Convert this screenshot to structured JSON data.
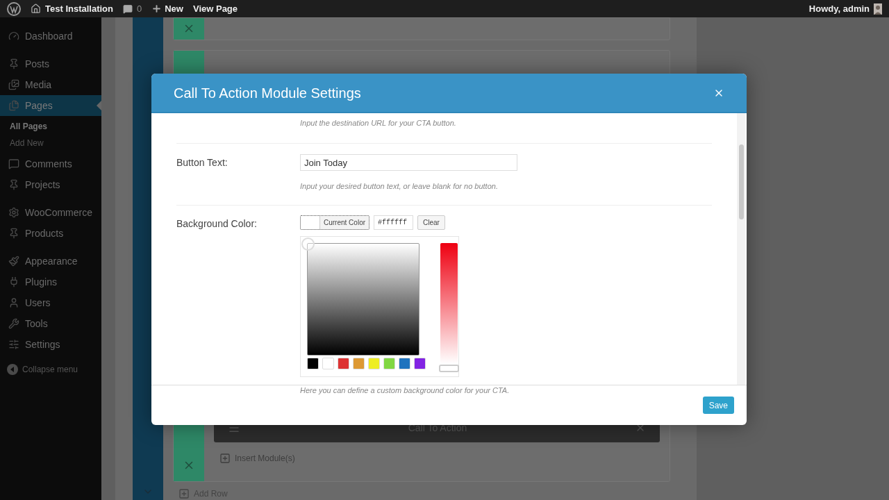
{
  "admin_bar": {
    "site_name": "Test Installation",
    "comments_count": "0",
    "new_label": "New",
    "view_label": "View Page",
    "greeting": "Howdy, admin"
  },
  "sidebar": {
    "groups": [
      [
        {
          "label": "Dashboard",
          "selected": false
        }
      ],
      [
        {
          "label": "Posts",
          "selected": false
        },
        {
          "label": "Media",
          "selected": false
        },
        {
          "label": "Pages",
          "selected": true,
          "children": [
            {
              "label": "All Pages",
              "selected": true
            },
            {
              "label": "Add New",
              "selected": false
            }
          ]
        },
        {
          "label": "Comments",
          "selected": false
        },
        {
          "label": "Projects",
          "selected": false
        }
      ],
      [
        {
          "label": "WooCommerce",
          "selected": false
        },
        {
          "label": "Products",
          "selected": false
        }
      ],
      [
        {
          "label": "Appearance",
          "selected": false
        },
        {
          "label": "Plugins",
          "selected": false
        },
        {
          "label": "Users",
          "selected": false
        },
        {
          "label": "Tools",
          "selected": false
        },
        {
          "label": "Settings",
          "selected": false
        }
      ]
    ],
    "collapse_label": "Collapse menu"
  },
  "builder": {
    "module_title": "Call To Action",
    "insert_label": "Insert Module(s)",
    "add_row_label": "Add Row"
  },
  "modal": {
    "title": "Call To Action Module Settings",
    "url_help": "Input the destination URL for your CTA button.",
    "button_text": {
      "label": "Button Text:",
      "value": "Join Today",
      "help": "Input your desired button text, or leave blank for no button."
    },
    "background_color": {
      "label": "Background Color:",
      "current_label": "Current Color",
      "hex_value": "#ffffff",
      "clear_label": "Clear",
      "hue_slider": {
        "level": 1
      },
      "swatches": [
        {
          "color": "#000000"
        },
        {
          "color": "#ffffff"
        },
        {
          "color": "#dd3333"
        },
        {
          "color": "#dd9933"
        },
        {
          "color": "#eeee22"
        },
        {
          "color": "#81d742"
        },
        {
          "color": "#1e73be"
        },
        {
          "color": "#8224e3"
        }
      ],
      "help": "Here you can define a custom background color for your CTA."
    },
    "save_label": "Save"
  }
}
